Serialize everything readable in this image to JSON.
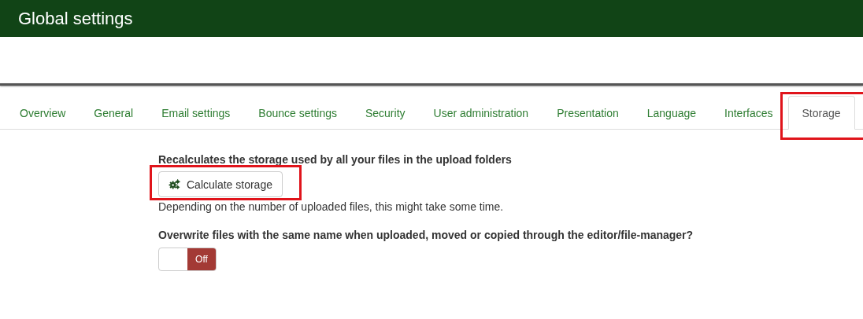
{
  "header": {
    "title": "Global settings"
  },
  "tabs": [
    {
      "label": "Overview",
      "selected": false,
      "highlighted": false
    },
    {
      "label": "General",
      "selected": false,
      "highlighted": false
    },
    {
      "label": "Email settings",
      "selected": false,
      "highlighted": false
    },
    {
      "label": "Bounce settings",
      "selected": false,
      "highlighted": false
    },
    {
      "label": "Security",
      "selected": false,
      "highlighted": false
    },
    {
      "label": "User administration",
      "selected": false,
      "highlighted": false
    },
    {
      "label": "Presentation",
      "selected": false,
      "highlighted": false
    },
    {
      "label": "Language",
      "selected": false,
      "highlighted": false
    },
    {
      "label": "Interfaces",
      "selected": false,
      "highlighted": false
    },
    {
      "label": "Storage",
      "selected": true,
      "highlighted": true
    }
  ],
  "storage": {
    "heading": "Recalculates the storage used by all your files in the upload folders",
    "button": {
      "label": "Calculate storage",
      "highlighted": true
    },
    "hint": "Depending on the number of uploaded files, this might take some time."
  },
  "overwrite": {
    "question": "Overwrite files with the same name when uploaded, moved or copied through the editor/file-manager?",
    "toggle": {
      "on": false,
      "label": "Off"
    }
  }
}
